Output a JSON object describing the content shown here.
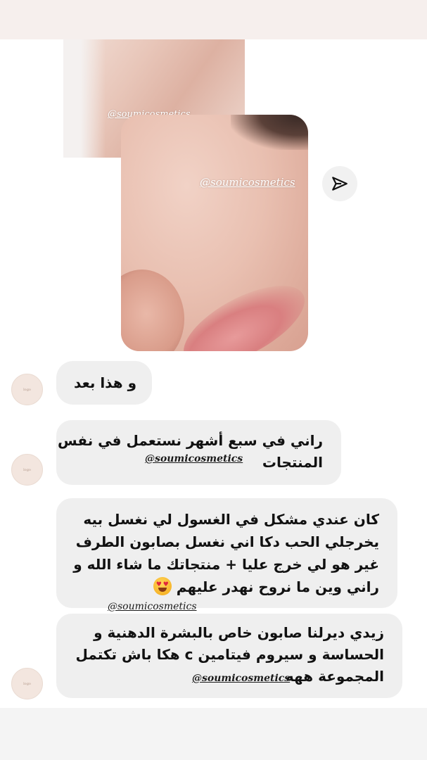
{
  "watermark": "@soumicosmetics",
  "messages": [
    {
      "text": "و هذا بعد"
    },
    {
      "lines": [
        "راني في سبع أشهر نستعمل في نفس",
        "المنتجات"
      ]
    },
    {
      "lines": [
        "كان عندي مشكل في الغسول لي نغسل بيه",
        "يخرجلي الحب دكا اني نغسل بصابون الطرف",
        "غير هو لي خرج عليا + منتجاتك ما شاء الله و",
        "راني وين ما نروح نهدر عليهم"
      ]
    },
    {
      "lines": [
        "زيدي ديرلنا صابون خاص بالبشرة الدهنية و",
        "الحساسة و سيروم فيتامين c هكا باش تكتمل",
        "المجموعة ههه"
      ]
    }
  ],
  "icons": {
    "share": "paper-plane-icon",
    "emoji": "heart-eyes-emoji-icon"
  },
  "colors": {
    "top_band": "#f6efed",
    "bubble": "#efefef",
    "avatar": "#f3e6df"
  }
}
